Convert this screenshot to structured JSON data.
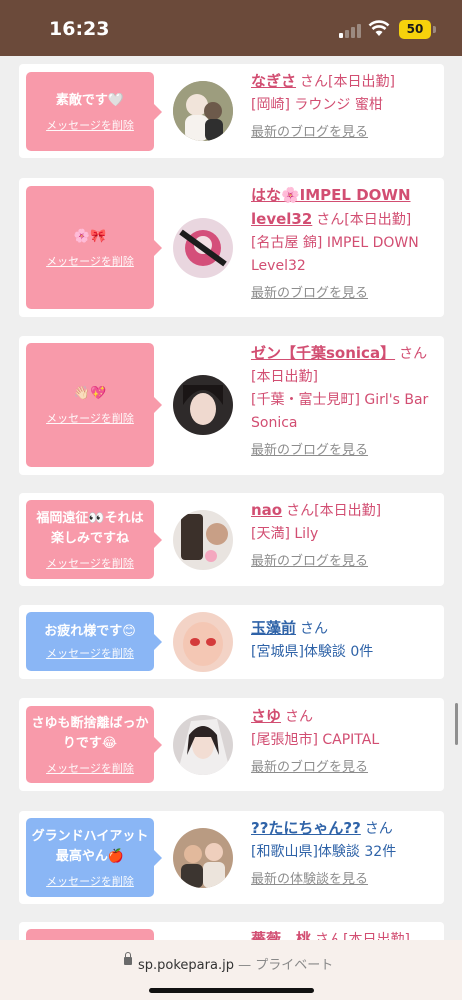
{
  "status_bar": {
    "time": "16:23",
    "battery": "50"
  },
  "cards": [
    {
      "bubble_text": "素敵です🤍",
      "delete_label": "メッセージを削除",
      "bubble_color": "pink",
      "name": "なぎさ",
      "san": "さん",
      "lines": [
        "[本日出勤]",
        "[岡崎] ラウンジ 蜜柑"
      ],
      "link": "最新のブログを見る",
      "avatar_color": "#b7a89a"
    },
    {
      "bubble_text": "🌸🎀",
      "delete_label": "メッセージを削除",
      "bubble_color": "pink",
      "name": "はな🌸IMPEL DOWN level32",
      "san": "さん",
      "lines": [
        "[本日出勤]",
        "[名古屋 錦] IMPEL DOWN Level32"
      ],
      "link": "最新のブログを見る",
      "avatar_color": "#d44f7a"
    },
    {
      "bubble_text": "👋🏻💖",
      "delete_label": "メッセージを削除",
      "bubble_color": "pink",
      "name": "ゼン【千葉sonica】",
      "san": "さん",
      "lines": [
        "[本日出勤]",
        "[千葉・富士見町] Girl's Bar Sonica"
      ],
      "link": "最新のブログを見る",
      "avatar_color": "#3a3030"
    },
    {
      "bubble_text": "福岡遠征👀それは楽しみですね",
      "delete_label": "メッセージを削除",
      "bubble_color": "pink",
      "name": "nao",
      "san": "さん",
      "lines": [
        "[本日出勤]",
        "[天満] Lily"
      ],
      "link": "最新のブログを見る",
      "avatar_color": "#6f5a4e"
    },
    {
      "bubble_text": "お疲れ様です😊",
      "delete_label": "メッセージを削除",
      "bubble_color": "blue",
      "name": "玉藻前",
      "san": "さん",
      "lines": [
        "[宮城県]体験談 0件"
      ],
      "link": "",
      "avatar_color": "#e4b8a6"
    },
    {
      "bubble_text": "さゆも断捨離ばっかりです😂",
      "delete_label": "メッセージを削除",
      "bubble_color": "pink",
      "name": "さゆ",
      "san": "さん",
      "lines": [
        "[尾張旭市] CAPITAL"
      ],
      "link": "最新のブログを見る",
      "avatar_color": "#d8d2d2"
    },
    {
      "bubble_text": "グランドハイアット最高やん🍎",
      "delete_label": "メッセージを削除",
      "bubble_color": "blue",
      "name": "??たにちゃん??",
      "san": "さん",
      "lines": [
        "[和歌山県]体験談 32件"
      ],
      "link": "最新の体験談を見る",
      "avatar_color": "#a7856c"
    },
    {
      "bubble_text": "",
      "delete_label": "",
      "bubble_color": "pink",
      "name": "薔薇　桃",
      "san": "さん",
      "lines": [
        "[本日出勤]"
      ],
      "link": "",
      "avatar_color": "#c9a3a3"
    }
  ],
  "browser": {
    "domain": "sp.pokepara.jp",
    "separator": "—",
    "mode": "プライベート"
  }
}
